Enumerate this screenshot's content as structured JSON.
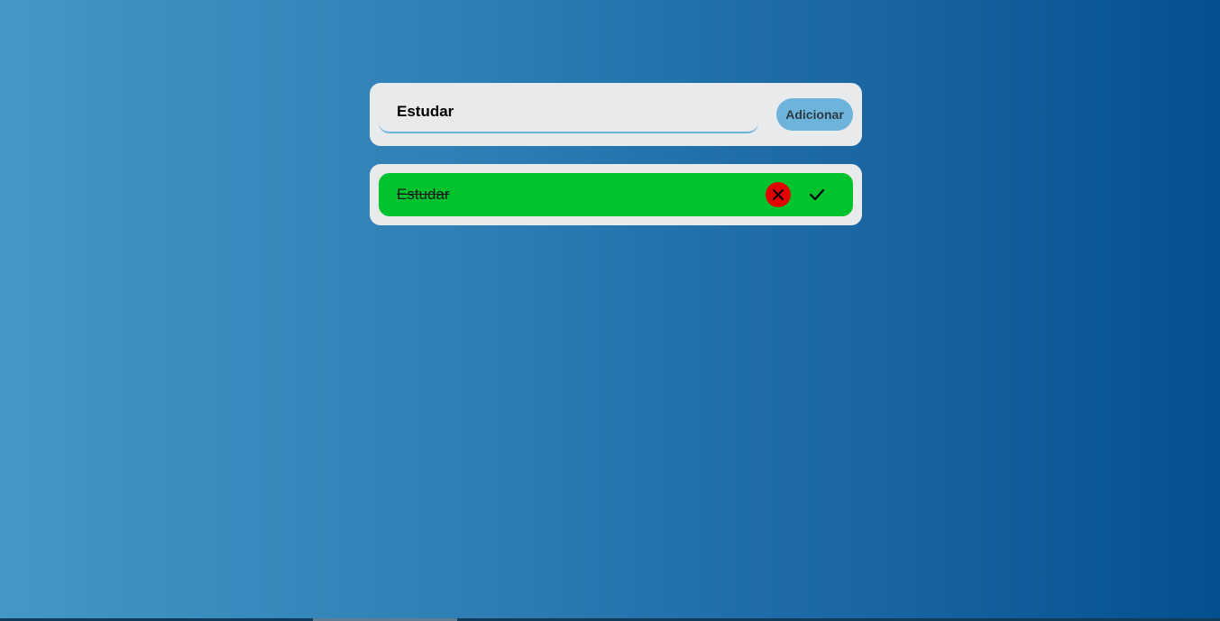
{
  "form": {
    "input_value": "Estudar",
    "add_label": "Adicionar"
  },
  "tasks": [
    {
      "text": "Estudar",
      "completed": true,
      "delete_icon": "close-icon",
      "complete_icon": "check-icon"
    }
  ],
  "colors": {
    "background_start": "#4497c7",
    "background_end": "#04508f",
    "card": "#e8eaeb",
    "button": "#6cb4da",
    "task_completed": "#00c32e",
    "delete": "#e40000"
  }
}
